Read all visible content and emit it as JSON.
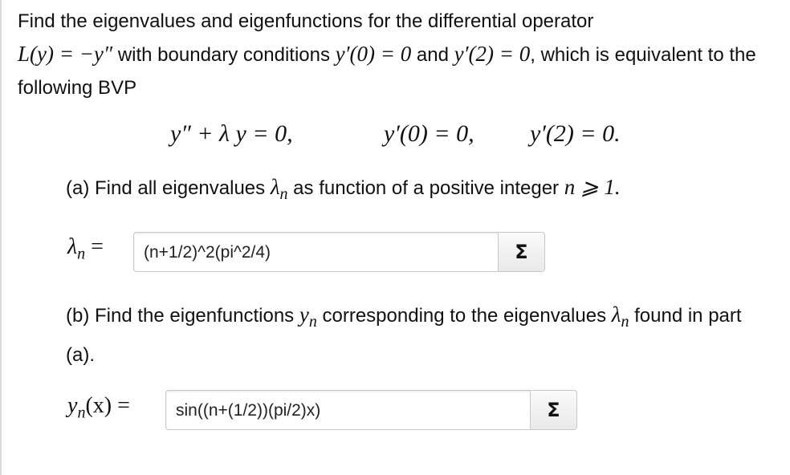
{
  "intro": {
    "line1": "Find the eigenvalues and eigenfunctions for the differential operator",
    "operator": "L(y) = −y″",
    "with_bc": " with boundary conditions ",
    "bc1": "y′(0) = 0",
    "and": " and ",
    "bc2": "y′(2) = 0",
    "tail": ", which is equivalent to the following BVP"
  },
  "bvp": {
    "eq": "y″ + λ y = 0,",
    "bc1": "y′(0) = 0,",
    "bc2": "y′(2) = 0."
  },
  "part_a": {
    "prompt_start": "(a) Find all eigenvalues ",
    "lambda": "λ",
    "sub_n": "n",
    "prompt_mid": " as function of a positive integer ",
    "cond": "n ⩾ 1.",
    "answer_label_sym": "λ",
    "answer_label_sub": "n",
    "answer_label_eq": " =",
    "answer_value": "(n+1/2)^2(pi^2/4)",
    "sigma": "Σ"
  },
  "part_b": {
    "prompt_start": "(b) Find the eigenfunctions ",
    "y": "y",
    "sub_n": "n",
    "prompt_mid": " corresponding to the eigenvalues ",
    "lambda": "λ",
    "lambda_sub": "n",
    "prompt_end": " found in part (a).",
    "answer_label_sym": "y",
    "answer_label_sub": "n",
    "answer_label_rest": "(x) =",
    "answer_value": "sin((n+(1/2))(pi/2)x)",
    "sigma": "Σ"
  }
}
